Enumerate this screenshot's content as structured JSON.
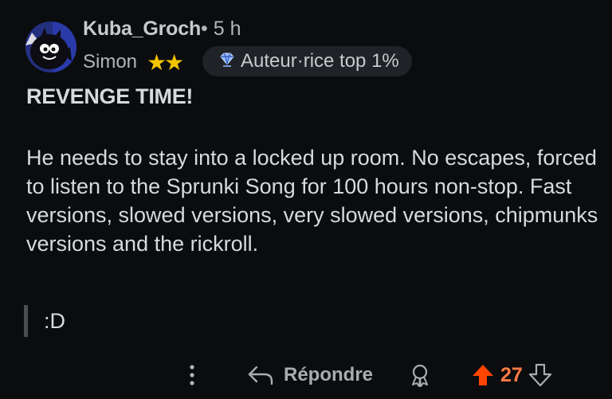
{
  "comment": {
    "author": "Kuba_Groch",
    "separator": "•",
    "age": "5 h",
    "flair_text": "Simon",
    "flair_stars": "★★",
    "badge_label": "Auteur·rice top 1%",
    "title": "REVENGE TIME!",
    "body": "He needs to stay into a locked up room. No escapes, forced to listen to the Sprunki Song for 100 hours non-stop. Fast versions, slowed versions, very slowed versions, chipmunks versions and the rickroll.",
    "quote": ":D"
  },
  "actions": {
    "more_icon": "more-vertical-icon",
    "reply_icon": "reply-arrow-icon",
    "reply_label": "Répondre",
    "award_icon": "award-icon",
    "upvote_icon": "upvote-arrow-icon",
    "vote_count": "27",
    "downvote_icon": "downvote-arrow-icon"
  },
  "colors": {
    "background": "#0b0c0e",
    "upvoted": "#ff4500",
    "vote_count": "#ff7a45",
    "stars": "#f3c400",
    "badge_bg": "#1f2226"
  }
}
